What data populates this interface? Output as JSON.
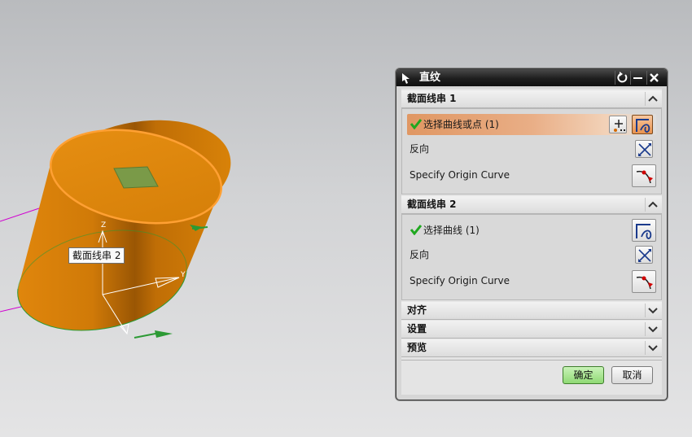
{
  "viewport": {
    "tooltip": "截面线串 2",
    "axis_z": "Z",
    "axis_y": "Y"
  },
  "dialog": {
    "title": "直纹",
    "group1": {
      "header": "截面线串 1",
      "select_label": "选择曲线或点 (1)",
      "reverse_label": "反向",
      "origin_label": "Specify Origin Curve"
    },
    "group2": {
      "header": "截面线串 2",
      "select_label": "选择曲线 (1)",
      "reverse_label": "反向",
      "origin_label": "Specify Origin Curve"
    },
    "sections": {
      "align": "对齐",
      "settings": "设置",
      "preview": "预览"
    },
    "buttons": {
      "ok": "确定",
      "cancel": "取消"
    }
  },
  "colors": {
    "solid": "#d9820a",
    "edge_highlight": "#ffa033",
    "active_row": "#e09763",
    "ok_button": "#8fd974",
    "title_bar": "#1e1e1e"
  }
}
